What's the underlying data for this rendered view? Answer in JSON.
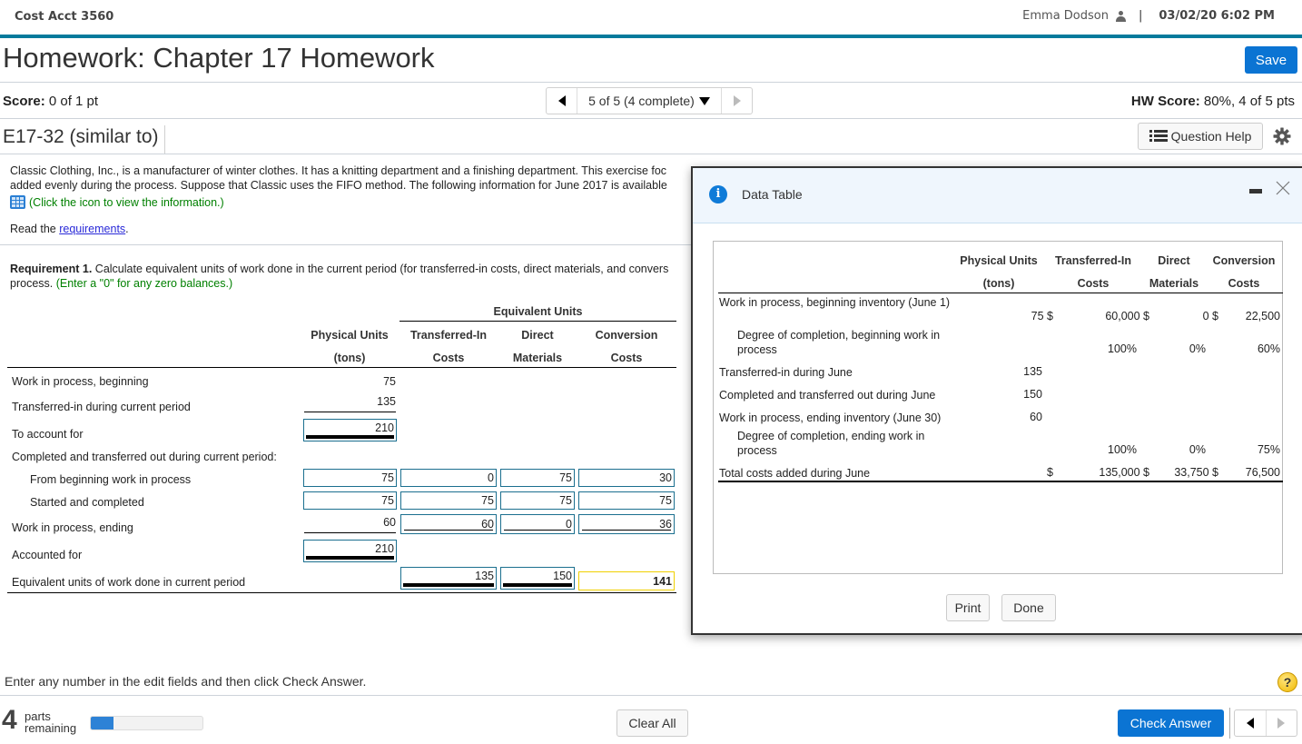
{
  "header": {
    "course": "Cost Acct 3560",
    "user": "Emma Dodson",
    "separator": "|",
    "datetime": "03/02/20 6:02 PM"
  },
  "title": "Homework: Chapter 17 Homework",
  "save_label": "Save",
  "score": {
    "label": "Score:",
    "value": "0 of 1 pt"
  },
  "pager": {
    "text": "5 of 5 (4 complete)"
  },
  "hw_score": {
    "label": "HW Score:",
    "value": "80%, 4 of 5 pts"
  },
  "question": {
    "id": "E17-32 (similar to)",
    "help_label": "Question Help"
  },
  "problem": {
    "line1": "Classic Clothing, Inc., is a manufacturer of winter clothes. It has a knitting department and a finishing department. This exercise foc",
    "line2": "added evenly during the process. Suppose that Classic uses the FIFO method. The following information for June 2017 is available",
    "info_link": "(Click the icon to view the information.)",
    "read_prefix": "Read the ",
    "read_link": "requirements",
    "read_suffix": "."
  },
  "requirement": {
    "label": "Requirement 1.",
    "text1": " Calculate equivalent units of work done in the current period (for transferred-in costs, direct materials, and convers",
    "text2": "process. ",
    "hint": "(Enter a \"0\" for any zero balances.)"
  },
  "worksheet": {
    "group_header": "Equivalent Units",
    "columns": [
      {
        "line1": "Physical Units",
        "line2": "(tons)"
      },
      {
        "line1": "Transferred-In",
        "line2": "Costs"
      },
      {
        "line1": "Direct",
        "line2": "Materials"
      },
      {
        "line1": "Conversion",
        "line2": "Costs"
      }
    ],
    "rows": [
      {
        "label": "Work in process, beginning",
        "physical": "75"
      },
      {
        "label": "Transferred-in during current period",
        "physical": "135"
      },
      {
        "label": "To account for",
        "physical": "210"
      },
      {
        "label": "Completed and transferred out during current period:"
      },
      {
        "label": "From beginning work in process",
        "values": [
          "75",
          "0",
          "75",
          "30"
        ]
      },
      {
        "label": "Started and completed",
        "values": [
          "75",
          "75",
          "75",
          "75"
        ]
      },
      {
        "label": "Work in process, ending",
        "values": [
          "60",
          "60",
          "0",
          "36"
        ]
      },
      {
        "label": "Accounted for",
        "physical": "210"
      },
      {
        "label": "Equivalent units of work done in current period",
        "values": [
          "",
          "135",
          "150",
          "141"
        ]
      }
    ]
  },
  "data_table": {
    "title": "Data Table",
    "columns": [
      {
        "line1": "Physical Units",
        "line2": "(tons)"
      },
      {
        "line1": "Transferred-In",
        "line2": "Costs"
      },
      {
        "line1": "Direct",
        "line2": "Materials"
      },
      {
        "line1": "Conversion",
        "line2": "Costs"
      }
    ],
    "rows": [
      {
        "label": "Work in process, beginning inventory (June 1)",
        "physical": "75 $",
        "transferred": "60,000 $",
        "materials": "0 $",
        "conversion": "22,500"
      },
      {
        "label": "Degree of completion, beginning work in process",
        "physical": "",
        "transferred": "100%",
        "materials": "0%",
        "conversion": "60%"
      },
      {
        "label": "Transferred-in during June",
        "physical": "135"
      },
      {
        "label": "Completed and transferred out during June",
        "physical": "150"
      },
      {
        "label": "Work in process, ending inventory (June 30)",
        "physical": "60"
      },
      {
        "label": "Degree of completion, ending work in process",
        "physical": "",
        "transferred": "100%",
        "materials": "0%",
        "conversion": "75%"
      },
      {
        "label": "Total costs added during June",
        "physical": "$",
        "transferred": "135,000 $",
        "materials": "33,750 $",
        "conversion": "76,500"
      }
    ],
    "print_label": "Print",
    "done_label": "Done"
  },
  "footer": {
    "instruction": "Enter any number in the edit fields and then click Check Answer.",
    "parts_count": "4",
    "parts_line1": "parts",
    "parts_line2": "remaining",
    "progress_fraction": 0.2,
    "clear_label": "Clear All",
    "check_label": "Check Answer"
  },
  "colors": {
    "accent_bar": "#047a9c",
    "primary_button": "#0b74d3",
    "input_border": "#1b6f8f",
    "hint_green": "#008000",
    "active_input": "#f0d000"
  }
}
